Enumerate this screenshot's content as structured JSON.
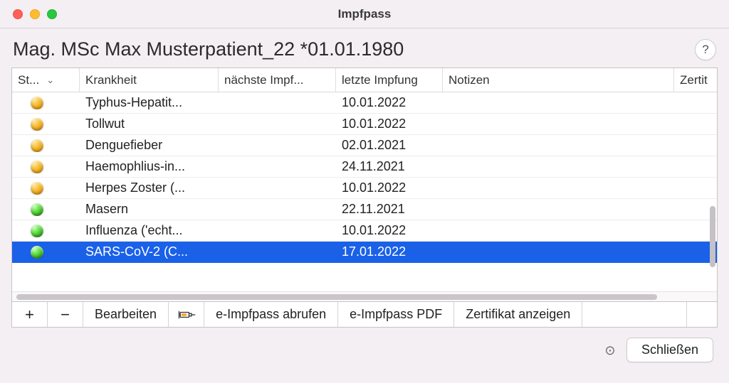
{
  "window": {
    "title": "Impfpass"
  },
  "header": {
    "patient_title": "Mag. MSc Max Musterpatient_22 *01.01.1980",
    "help_label": "?"
  },
  "columns": {
    "status": "St...",
    "disease": "Krankheit",
    "next": "nächste Impf...",
    "last": "letzte Impfung",
    "notes": "Notizen",
    "cert": "Zertit"
  },
  "rows": [
    {
      "status": "orange",
      "disease": "Typhus-Hepatit...",
      "next": "",
      "last": "10.01.2022",
      "notes": "",
      "selected": false
    },
    {
      "status": "orange",
      "disease": "Tollwut",
      "next": "",
      "last": "10.01.2022",
      "notes": "",
      "selected": false
    },
    {
      "status": "orange",
      "disease": "Denguefieber",
      "next": "",
      "last": "02.01.2021",
      "notes": "",
      "selected": false
    },
    {
      "status": "orange",
      "disease": "Haemophlius-in...",
      "next": "",
      "last": "24.11.2021",
      "notes": "",
      "selected": false
    },
    {
      "status": "orange",
      "disease": "Herpes Zoster (...",
      "next": "",
      "last": "10.01.2022",
      "notes": "",
      "selected": false
    },
    {
      "status": "green",
      "disease": "Masern",
      "next": "",
      "last": "22.11.2021",
      "notes": "",
      "selected": false
    },
    {
      "status": "green",
      "disease": "Influenza ('echt...",
      "next": "",
      "last": "10.01.2022",
      "notes": "",
      "selected": false
    },
    {
      "status": "green",
      "disease": "SARS-CoV-2 (C...",
      "next": "",
      "last": "17.01.2022",
      "notes": "",
      "selected": true
    }
  ],
  "toolbar": {
    "add": "+",
    "remove": "−",
    "edit": "Bearbeiten",
    "fetch_eimpfpass": "e-Impfpass abrufen",
    "pdf": "e-Impfpass PDF",
    "show_cert": "Zertifikat anzeigen"
  },
  "footer": {
    "close": "Schließen"
  },
  "colors": {
    "selection": "#1a61e8",
    "status_orange": "orange",
    "status_green": "green"
  }
}
